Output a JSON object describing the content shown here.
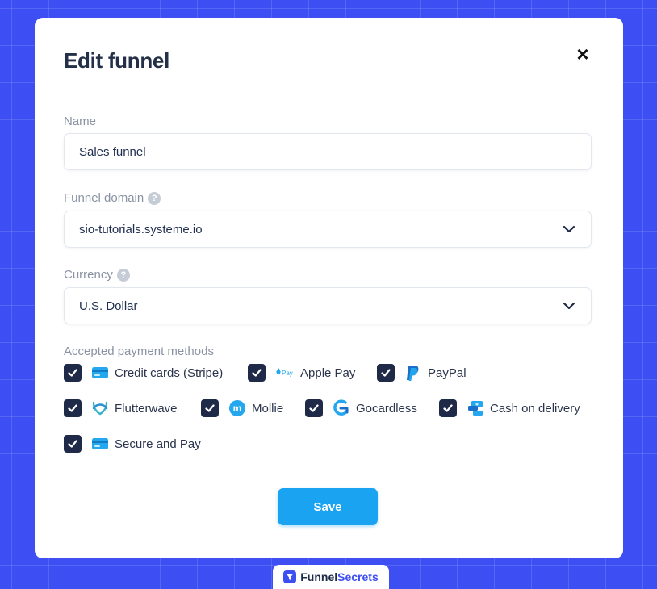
{
  "modal": {
    "title": "Edit funnel",
    "close_symbol": "×"
  },
  "name_field": {
    "label": "Name",
    "value": "Sales funnel"
  },
  "domain_field": {
    "label": "Funnel domain",
    "value": "sio-tutorials.systeme.io",
    "help_icon": "question-circle-icon",
    "arrow_icon": "chevron-down-icon"
  },
  "currency_field": {
    "label": "Currency",
    "value": "U.S. Dollar",
    "help_icon": "question-circle-icon",
    "arrow_icon": "chevron-down-icon"
  },
  "payment_methods": {
    "label": "Accepted payment methods",
    "items": [
      {
        "label": "Credit cards (Stripe)",
        "checked": true,
        "icon": "card-icon"
      },
      {
        "label": "Apple Pay",
        "checked": true,
        "icon": "apple-pay-icon"
      },
      {
        "label": "PayPal",
        "checked": true,
        "icon": "paypal-icon"
      },
      {
        "label": "Flutterwave",
        "checked": true,
        "icon": "flutterwave-icon"
      },
      {
        "label": "Mollie",
        "checked": true,
        "icon": "mollie-icon"
      },
      {
        "label": "Gocardless",
        "checked": true,
        "icon": "gocardless-icon"
      },
      {
        "label": "Cash on delivery",
        "checked": true,
        "icon": "cash-icon"
      },
      {
        "label": "Secure and Pay",
        "checked": true,
        "icon": "card-icon"
      }
    ]
  },
  "save_button": {
    "label": "Save"
  },
  "brand": {
    "part1": "Funnel",
    "part2": "Secrets"
  },
  "colors": {
    "background": "#3d4ff2",
    "checkbox": "#1f2a48",
    "save_button": "#1aa3f0",
    "title": "#233047"
  }
}
